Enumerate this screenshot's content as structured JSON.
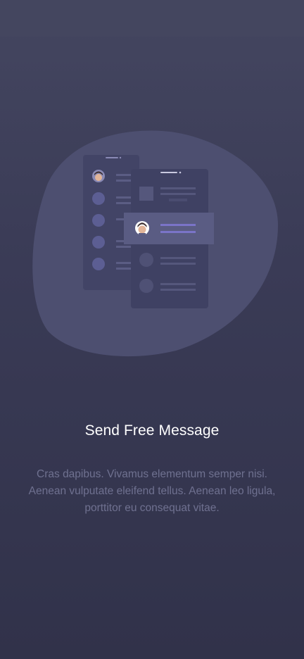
{
  "onboarding": {
    "title": "Send Free Message",
    "description": "Cras dapibus. Vivamus elementum semper nisi. Aenean vulputate eleifend tellus. Aenean leo ligula, porttitor eu consequat vitae."
  },
  "colors": {
    "background_top": "#444660",
    "background_bottom": "#31324a",
    "blob": "#4d4f70",
    "phone": "#424466",
    "highlight_card": "#5a5c83",
    "accent": "#7a74c8",
    "title_text": "#ffffff",
    "body_text": "#6f7190"
  },
  "illustration": {
    "icons": [
      "phone-back-icon",
      "phone-front-icon",
      "avatar-icon",
      "message-card-icon"
    ]
  }
}
